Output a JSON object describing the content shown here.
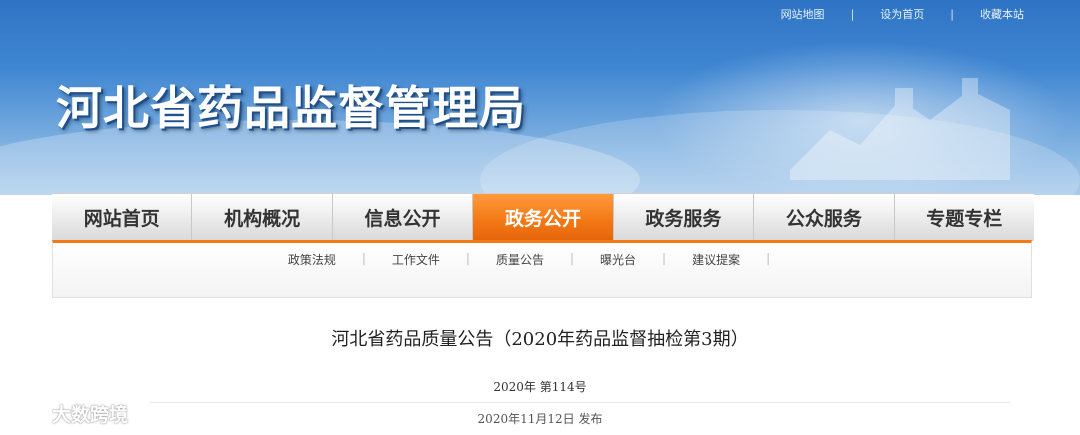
{
  "header": {
    "top_links": [
      "网站地图",
      "设为首页",
      "收藏本站"
    ],
    "top_separator": "|",
    "site_title": "河北省药品监督管理局"
  },
  "nav": {
    "items": [
      "网站首页",
      "机构概况",
      "信息公开",
      "政务公开",
      "政务服务",
      "公众服务",
      "专题专栏"
    ],
    "active": "政务公开"
  },
  "subnav": {
    "items": [
      "政策法规",
      "工作文件",
      "质量公告",
      "曝光台",
      "建议提案"
    ],
    "separator": "|"
  },
  "article": {
    "title": "河北省药品质量公告（2020年药品监督抽检第3期）",
    "issue": "2020年  第114号",
    "published": "2020年11月12日  发布"
  },
  "watermark": {
    "text": "大数跨境"
  },
  "colors": {
    "accent_orange": "#f47a16",
    "banner_blue": "#3f86d2"
  }
}
